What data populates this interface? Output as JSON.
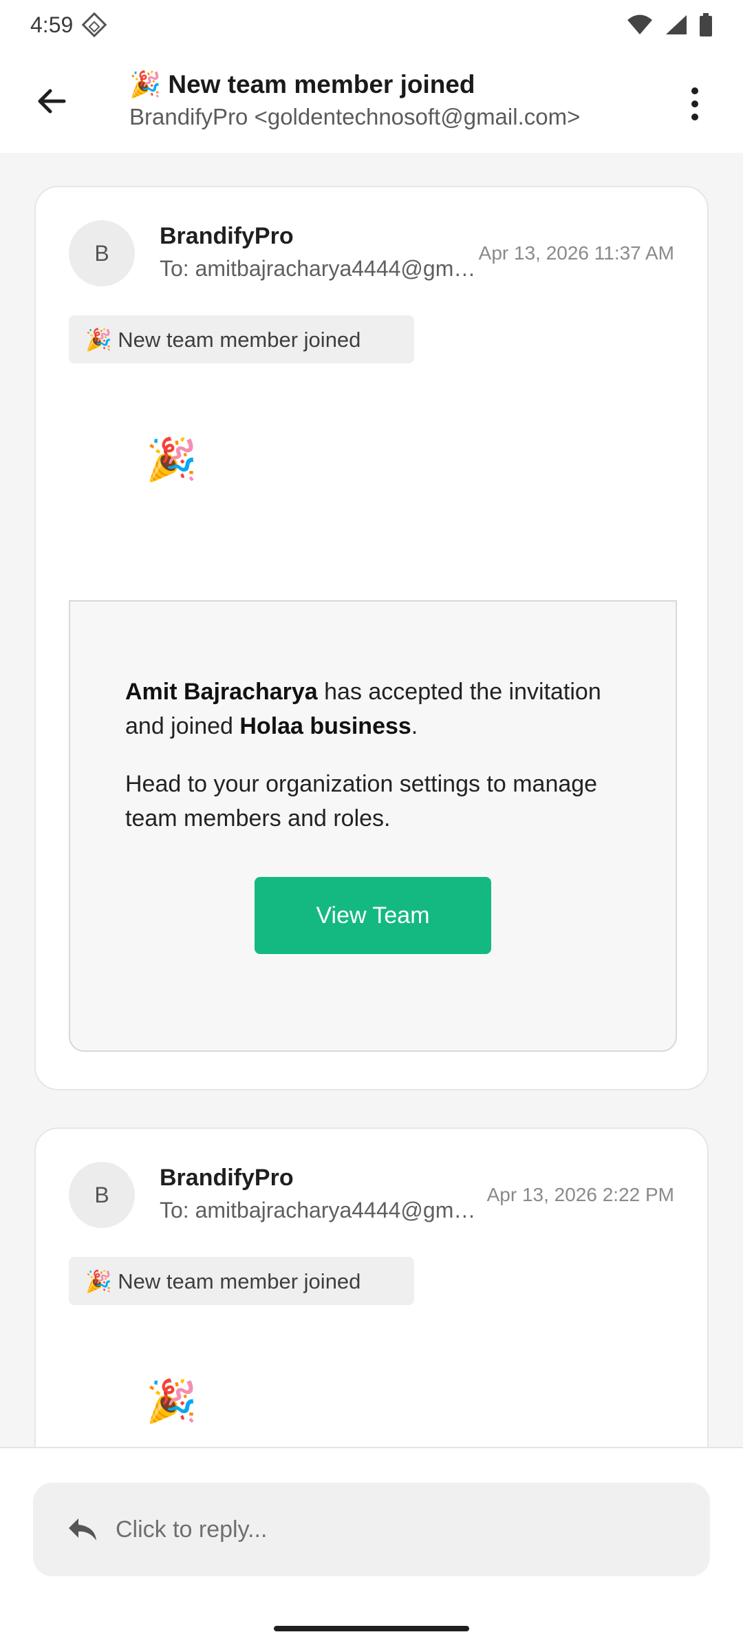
{
  "status_bar": {
    "time": "4:59"
  },
  "header": {
    "title": "🎉 New team member joined",
    "subtitle": "BrandifyPro <goldentechnosoft@gmail.com>"
  },
  "messages": [
    {
      "avatar_letter": "B",
      "sender": "BrandifyPro",
      "recipient": "To: amitbajracharya4444@gmail.com",
      "date": "Apr 13, 2026 11:37 AM",
      "subject": "🎉 New team member joined",
      "emoji": "🎉",
      "body": {
        "member_name": "Amit Bajracharya",
        "text_mid": " has accepted the invitation and joined ",
        "org_name": "Holaa business",
        "text_end": ".",
        "paragraph2": "Head to your organization settings to manage team members and roles.",
        "button_label": "View Team"
      }
    },
    {
      "avatar_letter": "B",
      "sender": "BrandifyPro",
      "recipient": "To: amitbajracharya4444@gmail.com",
      "date": "Apr 13, 2026 2:22 PM",
      "subject": "🎉 New team member joined",
      "emoji": "🎉"
    }
  ],
  "reply": {
    "placeholder": "Click to reply..."
  },
  "icons": [
    "diamond-icon",
    "wifi-icon",
    "signal-icon",
    "battery-icon",
    "back-arrow-icon",
    "more-vert-icon",
    "reply-icon"
  ],
  "colors": {
    "accent": "#13b981",
    "background": "#f5f5f5"
  }
}
